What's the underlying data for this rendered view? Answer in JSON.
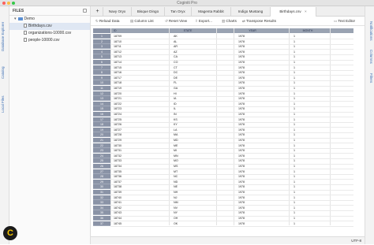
{
  "window": {
    "title": "Coginiti Pro"
  },
  "left_strip": {
    "tabs": [
      "Database Explorer",
      "Catalog",
      "Local Files"
    ]
  },
  "right_strip": {
    "tabs": [
      "Notifications",
      "Columns",
      "Filters"
    ]
  },
  "files_panel": {
    "title": "FILES",
    "folder": "Demo",
    "files": [
      "Birthdays.csv",
      "organizations-10000.csv",
      "people-10000.csv"
    ]
  },
  "tabs": [
    {
      "label": "+"
    },
    {
      "label": "Navy Oryx"
    },
    {
      "label": "Bisque Dingo"
    },
    {
      "label": "Tan Oryx"
    },
    {
      "label": "Magenta Rabbit"
    },
    {
      "label": "Indigo Mustang"
    },
    {
      "label": "Birthdays.csv"
    }
  ],
  "toolbar": {
    "reload": "Reload Data",
    "column_list": "Column List",
    "reset_view": "Reset View",
    "export": "Export...",
    "charts": "Charts",
    "transpose": "Transpose Results",
    "text_editor": "Text Editor"
  },
  "grid": {
    "columns": [
      "",
      "ID",
      "STATE",
      "",
      "YEAR",
      "MONTH"
    ],
    "rows": [
      [
        "1",
        "18709",
        "AK",
        "",
        "1978",
        "1"
      ],
      [
        "2",
        "18710",
        "AL",
        "",
        "1978",
        "1"
      ],
      [
        "3",
        "18711",
        "AR",
        "",
        "1978",
        "1"
      ],
      [
        "4",
        "18712",
        "AZ",
        "",
        "1978",
        "1"
      ],
      [
        "5",
        "18713",
        "CA",
        "",
        "1978",
        "1"
      ],
      [
        "6",
        "18714",
        "CO",
        "",
        "1978",
        "1"
      ],
      [
        "7",
        "18715",
        "CT",
        "",
        "1978",
        "1"
      ],
      [
        "8",
        "18716",
        "DC",
        "",
        "1978",
        "1"
      ],
      [
        "9",
        "18717",
        "DE",
        "",
        "1978",
        "1"
      ],
      [
        "10",
        "18718",
        "FL",
        "",
        "1978",
        "1"
      ],
      [
        "11",
        "18719",
        "GA",
        "",
        "1978",
        "1"
      ],
      [
        "12",
        "18720",
        "HI",
        "",
        "1978",
        "1"
      ],
      [
        "13",
        "18721",
        "IA",
        "",
        "1978",
        "1"
      ],
      [
        "14",
        "18722",
        "ID",
        "",
        "1978",
        "1"
      ],
      [
        "15",
        "18723",
        "IL",
        "",
        "1978",
        "1"
      ],
      [
        "16",
        "18724",
        "IN",
        "",
        "1978",
        "1"
      ],
      [
        "17",
        "18725",
        "KS",
        "",
        "1978",
        "1"
      ],
      [
        "18",
        "18726",
        "KY",
        "",
        "1978",
        "1"
      ],
      [
        "19",
        "18727",
        "LA",
        "",
        "1978",
        "1"
      ],
      [
        "20",
        "18728",
        "MA",
        "",
        "1978",
        "1"
      ],
      [
        "21",
        "18729",
        "MD",
        "",
        "1978",
        "1"
      ],
      [
        "22",
        "18730",
        "ME",
        "",
        "1978",
        "1"
      ],
      [
        "23",
        "18731",
        "MI",
        "",
        "1978",
        "1"
      ],
      [
        "24",
        "18732",
        "MN",
        "",
        "1978",
        "1"
      ],
      [
        "25",
        "18733",
        "MO",
        "",
        "1978",
        "1"
      ],
      [
        "26",
        "18734",
        "MS",
        "",
        "1978",
        "1"
      ],
      [
        "27",
        "18735",
        "MT",
        "",
        "1978",
        "1"
      ],
      [
        "28",
        "18736",
        "NC",
        "",
        "1978",
        "1"
      ],
      [
        "29",
        "18737",
        "ND",
        "",
        "1978",
        "1"
      ],
      [
        "30",
        "18738",
        "NE",
        "",
        "1978",
        "1"
      ],
      [
        "31",
        "18739",
        "NH",
        "",
        "1978",
        "1"
      ],
      [
        "32",
        "18740",
        "NJ",
        "",
        "1978",
        "1"
      ],
      [
        "33",
        "18741",
        "NM",
        "",
        "1978",
        "1"
      ],
      [
        "34",
        "18742",
        "NV",
        "",
        "1978",
        "1"
      ],
      [
        "35",
        "18743",
        "NY",
        "",
        "1978",
        "1"
      ],
      [
        "36",
        "18744",
        "OH",
        "",
        "1978",
        "1"
      ],
      [
        "37",
        "18745",
        "OK",
        "",
        "1978",
        "1"
      ]
    ]
  },
  "status": {
    "right": "UTF-8"
  },
  "colors": {
    "header": "#9aa3b2",
    "rownum": "#8a93a6",
    "accent": "#3d6fb5",
    "logo_bg": "#1a1a1a",
    "logo_fg": "#f5c400"
  }
}
